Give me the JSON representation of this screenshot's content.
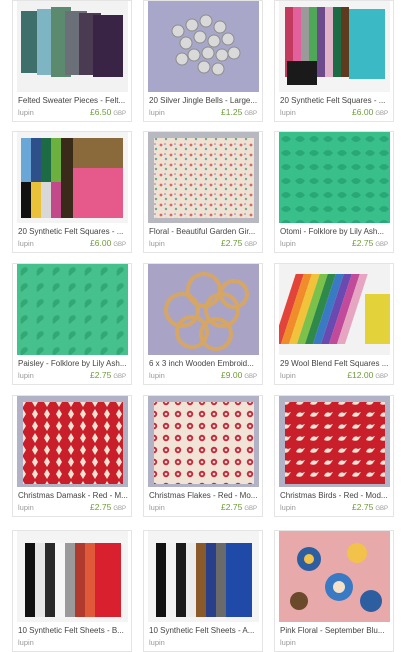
{
  "listings": [
    {
      "title": "Felted Sweater Pieces - Felt...",
      "shop": "lupin",
      "price": "£6.50",
      "currency": "GBP",
      "image": "felted-sweater-pieces"
    },
    {
      "title": "20 Silver Jingle Bells - Large...",
      "shop": "lupin",
      "price": "£1.25",
      "currency": "GBP",
      "image": "silver-jingle-bells"
    },
    {
      "title": "20 Synthetic Felt Squares - ...",
      "shop": "lupin",
      "price": "£6.00",
      "currency": "GBP",
      "image": "synthetic-felt-squares"
    },
    {
      "title": "20 Synthetic Felt Squares - ...",
      "shop": "lupin",
      "price": "£6.00",
      "currency": "GBP",
      "image": "synthetic-felt-squares-bright"
    },
    {
      "title": "Floral - Beautiful Garden Gir...",
      "shop": "lupin",
      "price": "£2.75",
      "currency": "GBP",
      "image": "floral-fabric"
    },
    {
      "title": "Otomi - Folklore by Lily Ash...",
      "shop": "lupin",
      "price": "£2.75",
      "currency": "GBP",
      "image": "otomi-green-fabric"
    },
    {
      "title": "Paisley - Folklore by Lily Ash...",
      "shop": "lupin",
      "price": "£2.75",
      "currency": "GBP",
      "image": "paisley-green-fabric"
    },
    {
      "title": "6 x 3 inch Wooden Embroid...",
      "shop": "lupin",
      "price": "£9.00",
      "currency": "GBP",
      "image": "wooden-embroidery-hoops"
    },
    {
      "title": "29 Wool Blend Felt Squares ...",
      "shop": "lupin",
      "price": "£12.00",
      "currency": "GBP",
      "image": "wool-blend-felt-squares"
    },
    {
      "title": "Christmas Damask - Red - M...",
      "shop": "lupin",
      "price": "£2.75",
      "currency": "GBP",
      "image": "christmas-damask-red"
    },
    {
      "title": "Christmas Flakes - Red - Mo...",
      "shop": "lupin",
      "price": "£2.75",
      "currency": "GBP",
      "image": "christmas-flakes-red"
    },
    {
      "title": "Christmas Birds - Red - Mod...",
      "shop": "lupin",
      "price": "£2.75",
      "currency": "GBP",
      "image": "christmas-birds-red"
    },
    {
      "title": "10 Synthetic Felt Sheets - B...",
      "shop": "lupin",
      "price": "",
      "currency": "",
      "image": "felt-sheets-black"
    },
    {
      "title": "10 Synthetic Felt Sheets - A...",
      "shop": "lupin",
      "price": "",
      "currency": "",
      "image": "felt-sheets-assorted"
    },
    {
      "title": "Pink Floral - September Blu...",
      "shop": "lupin",
      "price": "",
      "currency": "",
      "image": "pink-floral-fabric"
    }
  ],
  "colors": {
    "price": "#6e9c3a",
    "shop": "#999999",
    "title": "#444444",
    "border": "#e4e4e4"
  }
}
